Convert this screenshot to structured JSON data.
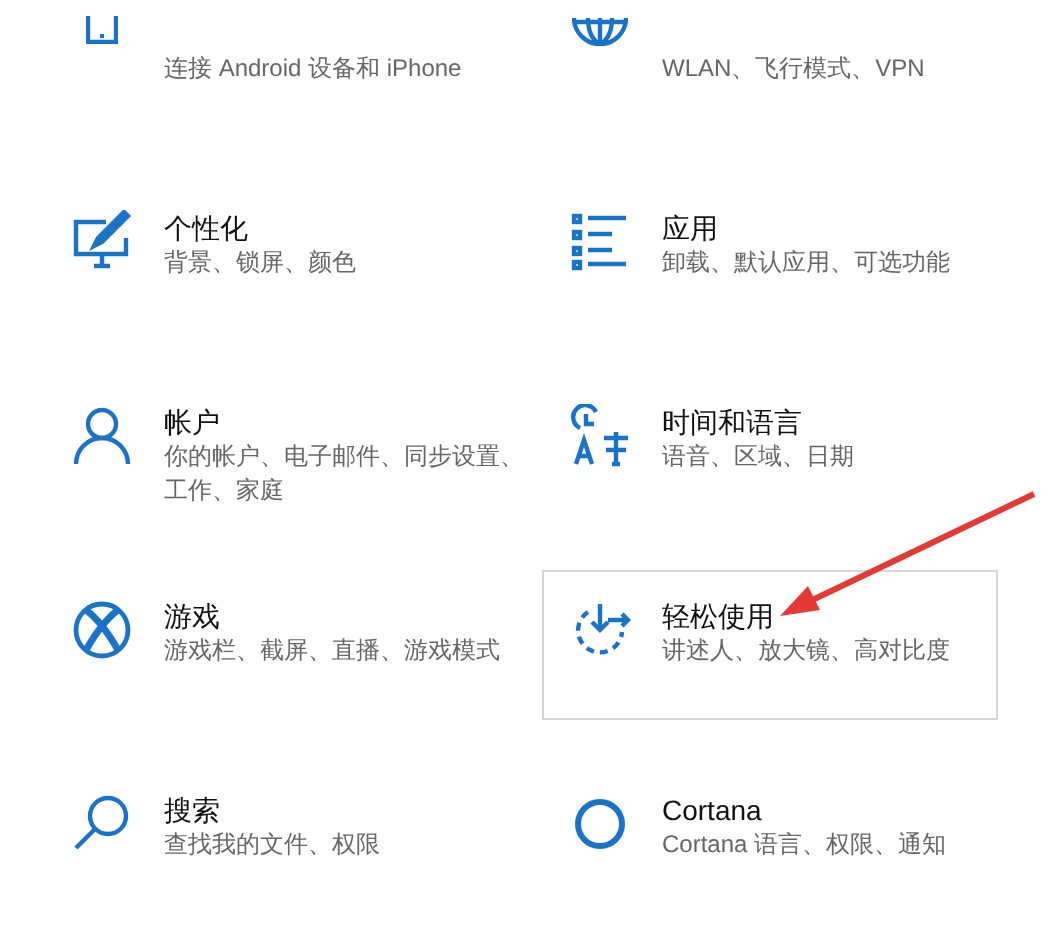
{
  "tiles": [
    {
      "description": "连接 Android 设备和 iPhone",
      "selected": false
    },
    {
      "description": "WLAN、飞行模式、VPN",
      "selected": false
    },
    {
      "title": "个性化",
      "description": "背景、锁屏、颜色",
      "selected": false
    },
    {
      "title": "应用",
      "description": "卸载、默认应用、可选功能",
      "selected": false
    },
    {
      "title": "帐户",
      "description": "你的帐户、电子邮件、同步设置、工作、家庭",
      "selected": false
    },
    {
      "title": "时间和语言",
      "description": "语音、区域、日期",
      "selected": false
    },
    {
      "title": "游戏",
      "description": "游戏栏、截屏、直播、游戏模式",
      "selected": false
    },
    {
      "title": "轻松使用",
      "description": "讲述人、放大镜、高对比度",
      "selected": true
    },
    {
      "title": "搜索",
      "description": "查找我的文件、权限",
      "selected": false
    },
    {
      "title": "Cortana",
      "description": "Cortana 语言、权限、通知",
      "selected": false
    }
  ],
  "annotation": {
    "kind": "arrow",
    "color": "#e53935"
  }
}
